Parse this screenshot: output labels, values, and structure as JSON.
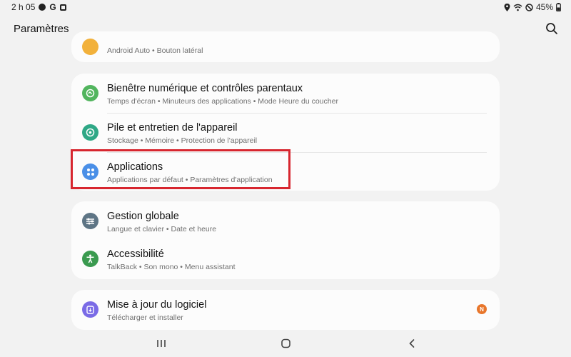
{
  "status": {
    "time": "2 h 05",
    "g_letter": "G",
    "battery": "45%"
  },
  "header": {
    "title": "Paramètres"
  },
  "partial_item": {
    "subtitle": "Android Auto  •  Bouton latéral"
  },
  "group1": [
    {
      "title": "Bienêtre numérique et contrôles parentaux",
      "subtitle": "Temps d'écran  •  Minuteurs des applications  •  Mode Heure du coucher",
      "color": "#52b55e"
    },
    {
      "title": "Pile et entretien de l'appareil",
      "subtitle": "Stockage  •  Mémoire  •  Protection de l'appareil",
      "color": "#2fa886"
    },
    {
      "title": "Applications",
      "subtitle": "Applications par défaut  •  Paramètres d'application",
      "color": "#4a8fe7"
    }
  ],
  "group2": [
    {
      "title": "Gestion globale",
      "subtitle": "Langue et clavier  •  Date et heure",
      "color": "#5e7585"
    },
    {
      "title": "Accessibilité",
      "subtitle": "TalkBack  •  Son mono  •  Menu assistant",
      "color": "#3a9a4f"
    }
  ],
  "group3": [
    {
      "title": "Mise à jour du logiciel",
      "subtitle": "Télécharger et installer",
      "color": "#7a6be6",
      "badge": "N"
    }
  ],
  "colors": {
    "highlight": "#d7262f",
    "badge": "#e8762b",
    "partial_icon": "#f2b13b"
  }
}
